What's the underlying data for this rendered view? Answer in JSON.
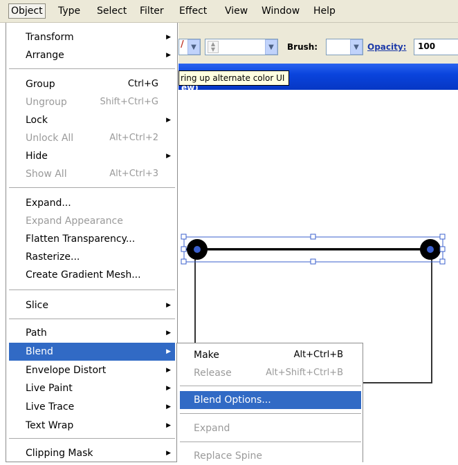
{
  "menubar": {
    "items": [
      "Object",
      "Type",
      "Select",
      "Filter",
      "Effect",
      "View",
      "Window",
      "Help"
    ],
    "active": "Object"
  },
  "controlbar": {
    "brush_label": "Brush:",
    "opacity_label": "Opacity:",
    "opacity_value": "100"
  },
  "tooltip": "ring up alternate color UI",
  "document": {
    "title_partial": "ew)"
  },
  "object_menu": {
    "items": [
      {
        "label": "Transform",
        "shortcut": "",
        "submenu": true,
        "disabled": false
      },
      {
        "label": "Arrange",
        "shortcut": "",
        "submenu": true,
        "disabled": false
      },
      {
        "label": "Group",
        "shortcut": "Ctrl+G",
        "submenu": false,
        "disabled": false
      },
      {
        "label": "Ungroup",
        "shortcut": "Shift+Ctrl+G",
        "submenu": false,
        "disabled": true
      },
      {
        "label": "Lock",
        "shortcut": "",
        "submenu": true,
        "disabled": false
      },
      {
        "label": "Unlock All",
        "shortcut": "Alt+Ctrl+2",
        "submenu": false,
        "disabled": true
      },
      {
        "label": "Hide",
        "shortcut": "",
        "submenu": true,
        "disabled": false
      },
      {
        "label": "Show All",
        "shortcut": "Alt+Ctrl+3",
        "submenu": false,
        "disabled": true
      },
      {
        "label": "Expand...",
        "shortcut": "",
        "submenu": false,
        "disabled": false
      },
      {
        "label": "Expand Appearance",
        "shortcut": "",
        "submenu": false,
        "disabled": true
      },
      {
        "label": "Flatten Transparency...",
        "shortcut": "",
        "submenu": false,
        "disabled": false
      },
      {
        "label": "Rasterize...",
        "shortcut": "",
        "submenu": false,
        "disabled": false
      },
      {
        "label": "Create Gradient Mesh...",
        "shortcut": "",
        "submenu": false,
        "disabled": false
      },
      {
        "label": "Slice",
        "shortcut": "",
        "submenu": true,
        "disabled": false
      },
      {
        "label": "Path",
        "shortcut": "",
        "submenu": true,
        "disabled": false
      },
      {
        "label": "Blend",
        "shortcut": "",
        "submenu": true,
        "disabled": false,
        "highlighted": true
      },
      {
        "label": "Envelope Distort",
        "shortcut": "",
        "submenu": true,
        "disabled": false
      },
      {
        "label": "Live Paint",
        "shortcut": "",
        "submenu": true,
        "disabled": false
      },
      {
        "label": "Live Trace",
        "shortcut": "",
        "submenu": true,
        "disabled": false
      },
      {
        "label": "Text Wrap",
        "shortcut": "",
        "submenu": true,
        "disabled": false
      },
      {
        "label": "Clipping Mask",
        "shortcut": "",
        "submenu": true,
        "disabled": false
      }
    ]
  },
  "blend_submenu": {
    "items": [
      {
        "label": "Make",
        "shortcut": "Alt+Ctrl+B",
        "disabled": false
      },
      {
        "label": "Release",
        "shortcut": "Alt+Shift+Ctrl+B",
        "disabled": true
      },
      {
        "label": "Blend Options...",
        "shortcut": "",
        "disabled": false,
        "highlighted": true
      },
      {
        "label": "Expand",
        "shortcut": "",
        "disabled": true
      },
      {
        "label": "Replace Spine",
        "shortcut": "",
        "disabled": true
      }
    ]
  },
  "icons": [
    "submenu-arrow-icon",
    "dropdown-arrow-icon",
    "spinner-icon"
  ],
  "colors": {
    "highlight": "#316ac5",
    "selection": "#3a5fcd",
    "titlebar": "#0a44dd"
  }
}
